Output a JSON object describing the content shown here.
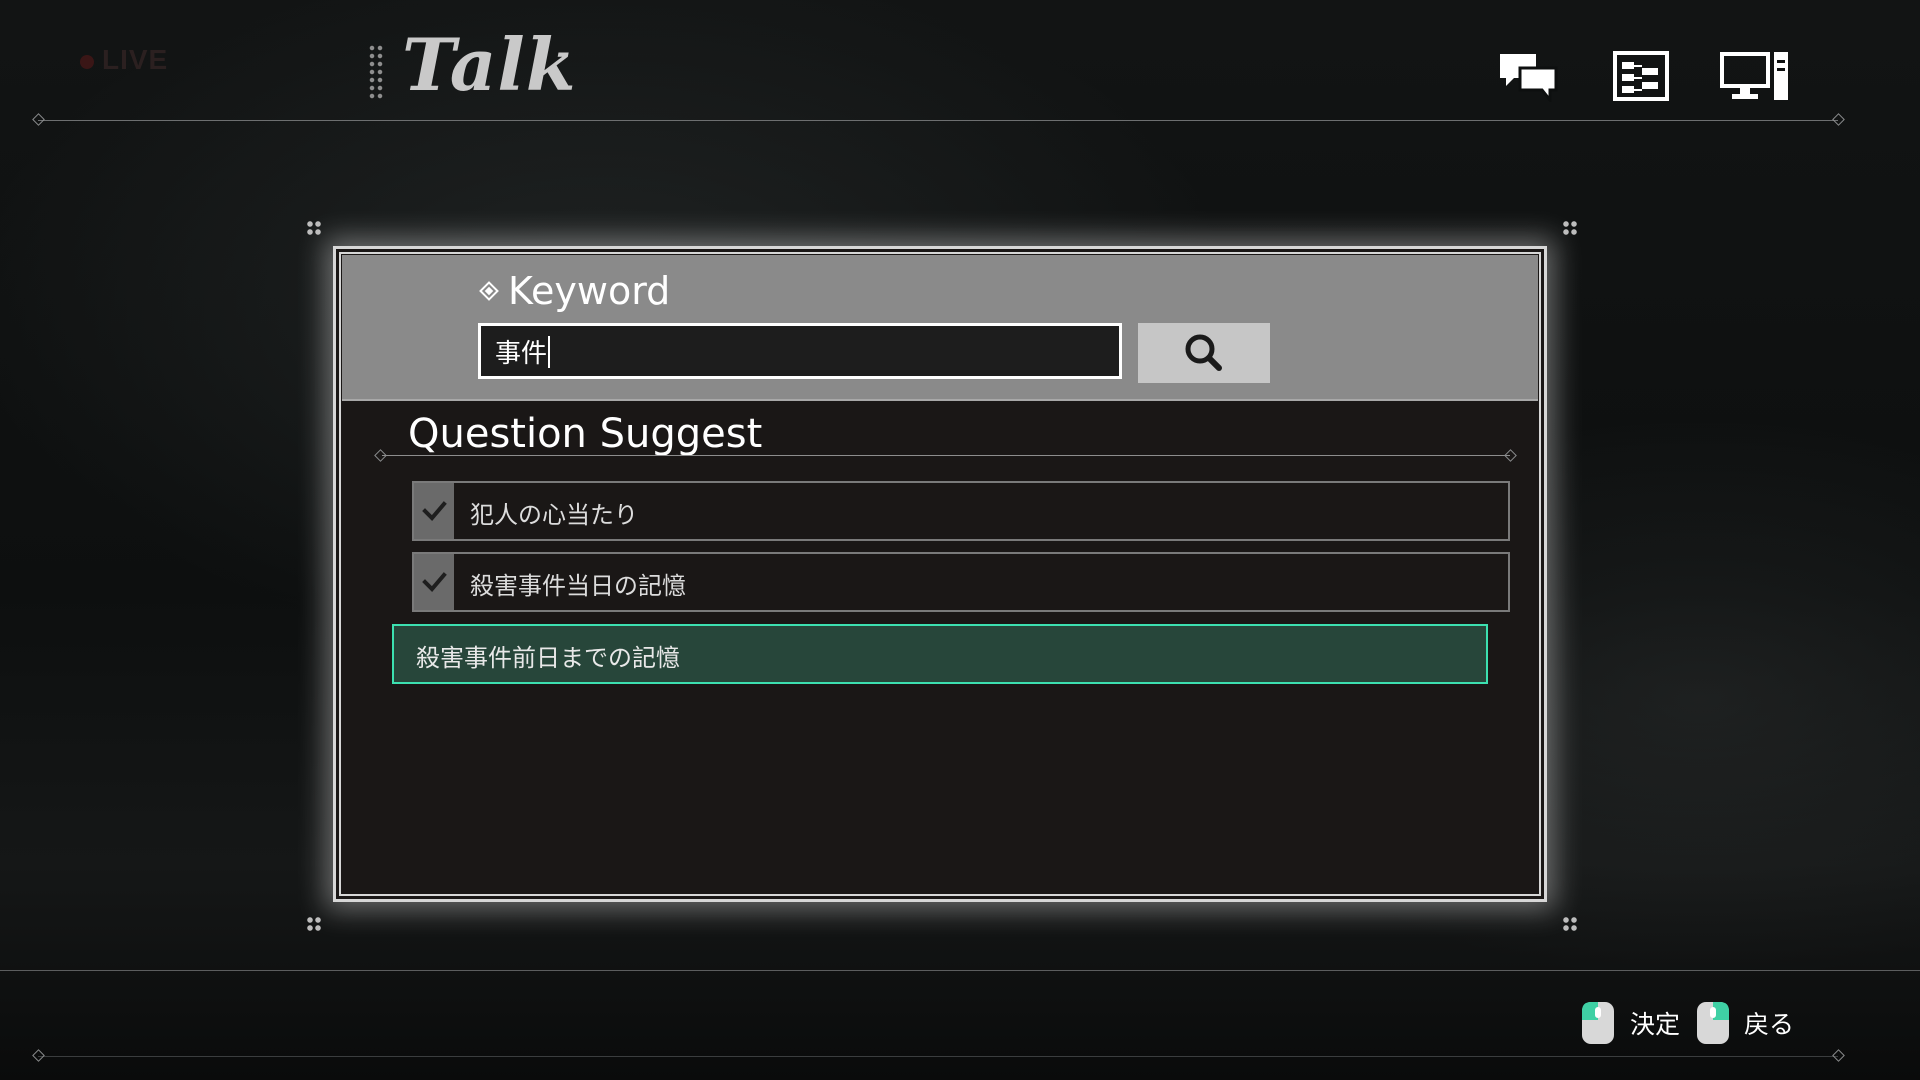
{
  "header": {
    "live_label": "LIVE",
    "title": "Talk",
    "icons": [
      "chat-bubbles-icon",
      "flowchart-icon",
      "monitor-icon"
    ]
  },
  "dialog": {
    "keyword_label": "Keyword",
    "keyword_value": "事件",
    "search_button_icon": "search-icon",
    "section_title": "Question Suggest",
    "suggestions": [
      {
        "label": "犯人の心当たり",
        "checked": true,
        "selected": false
      },
      {
        "label": "殺害事件当日の記憶",
        "checked": true,
        "selected": false
      },
      {
        "label": "殺害事件前日までの記憶",
        "checked": false,
        "selected": true
      }
    ]
  },
  "footer": {
    "hints": [
      {
        "icon": "mouse-left-click-icon",
        "label": "決定"
      },
      {
        "icon": "mouse-right-click-icon",
        "label": "戻る"
      }
    ]
  },
  "colors": {
    "selection_border": "#3ce0b0",
    "selection_fill": "#27463a",
    "panel_header": "#8a8a8a"
  }
}
